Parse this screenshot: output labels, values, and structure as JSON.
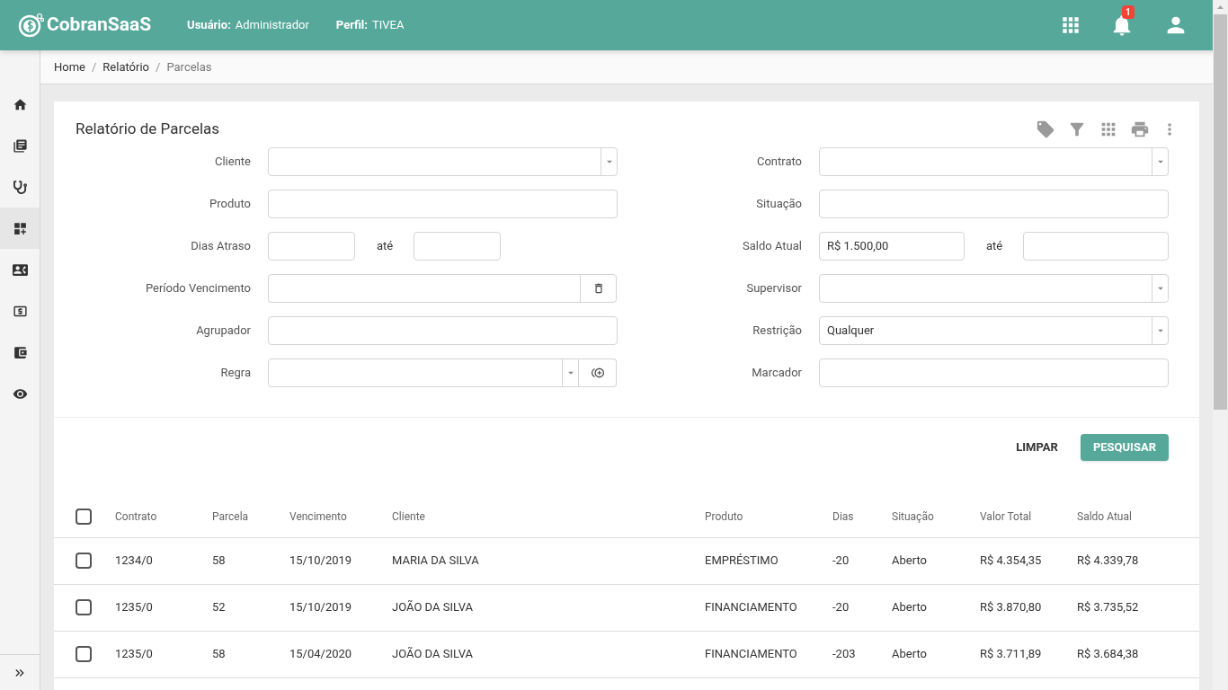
{
  "header": {
    "brand": "CobranSaaS",
    "user_label": "Usuário:",
    "user_value": "Administrador",
    "profile_label": "Perfil:",
    "profile_value": "TIVEA",
    "notification_count": "1"
  },
  "sidebar": {
    "items": [
      {
        "kind": "home",
        "selected": false
      },
      {
        "kind": "library",
        "selected": false
      },
      {
        "kind": "stethoscope",
        "selected": false
      },
      {
        "kind": "dashboard",
        "selected": true
      },
      {
        "kind": "contact",
        "selected": false
      },
      {
        "kind": "money",
        "selected": false
      },
      {
        "kind": "wallet",
        "selected": false
      },
      {
        "kind": "eye",
        "selected": false
      }
    ]
  },
  "breadcrumb": [
    "Home",
    "Relatório",
    "Parcelas"
  ],
  "breadcrumb_separator": "/",
  "card": {
    "title": "Relatório de Parcelas"
  },
  "filters": {
    "left": [
      {
        "label": "Cliente",
        "kind": "select"
      },
      {
        "label": "Produto",
        "kind": "text"
      },
      {
        "label": "Dias Atraso",
        "kind": "range",
        "connector": "até"
      },
      {
        "label": "Período Vencimento",
        "kind": "date"
      },
      {
        "label": "Agrupador",
        "kind": "text"
      },
      {
        "label": "Regra",
        "kind": "rule"
      }
    ],
    "right": [
      {
        "label": "Contrato",
        "kind": "select"
      },
      {
        "label": "Situação",
        "kind": "text"
      },
      {
        "label": "Saldo Atual",
        "kind": "range",
        "connector": "até",
        "from_value": "R$ 1.500,00"
      },
      {
        "label": "Supervisor",
        "kind": "select"
      },
      {
        "label": "Restrição",
        "kind": "select",
        "value": "Qualquer"
      },
      {
        "label": "Marcador",
        "kind": "text"
      }
    ]
  },
  "actions": {
    "clear": "LIMPAR",
    "search": "PESQUISAR"
  },
  "table": {
    "select_all_checked": false,
    "columns": [
      "Contrato",
      "Parcela",
      "Vencimento",
      "Cliente",
      "Produto",
      "Dias",
      "Situação",
      "Valor Total",
      "Saldo Atual"
    ],
    "rows": [
      {
        "checked": false,
        "cells": [
          "1234/0",
          "58",
          "15/10/2019",
          "MARIA DA SILVA",
          "EMPRÉSTIMO",
          "-20",
          "Aberto",
          "R$ 4.354,35",
          "R$ 4.339,78"
        ]
      },
      {
        "checked": false,
        "cells": [
          "1235/0",
          "52",
          "15/10/2019",
          "JOÃO DA SILVA",
          "FINANCIAMENTO",
          "-20",
          "Aberto",
          "R$ 3.870,80",
          "R$ 3.735,52"
        ]
      },
      {
        "checked": false,
        "cells": [
          "1235/0",
          "58",
          "15/04/2020",
          "JOÃO DA SILVA",
          "FINANCIAMENTO",
          "-203",
          "Aberto",
          "R$ 3.711,89",
          "R$ 3.684,38"
        ]
      }
    ]
  }
}
